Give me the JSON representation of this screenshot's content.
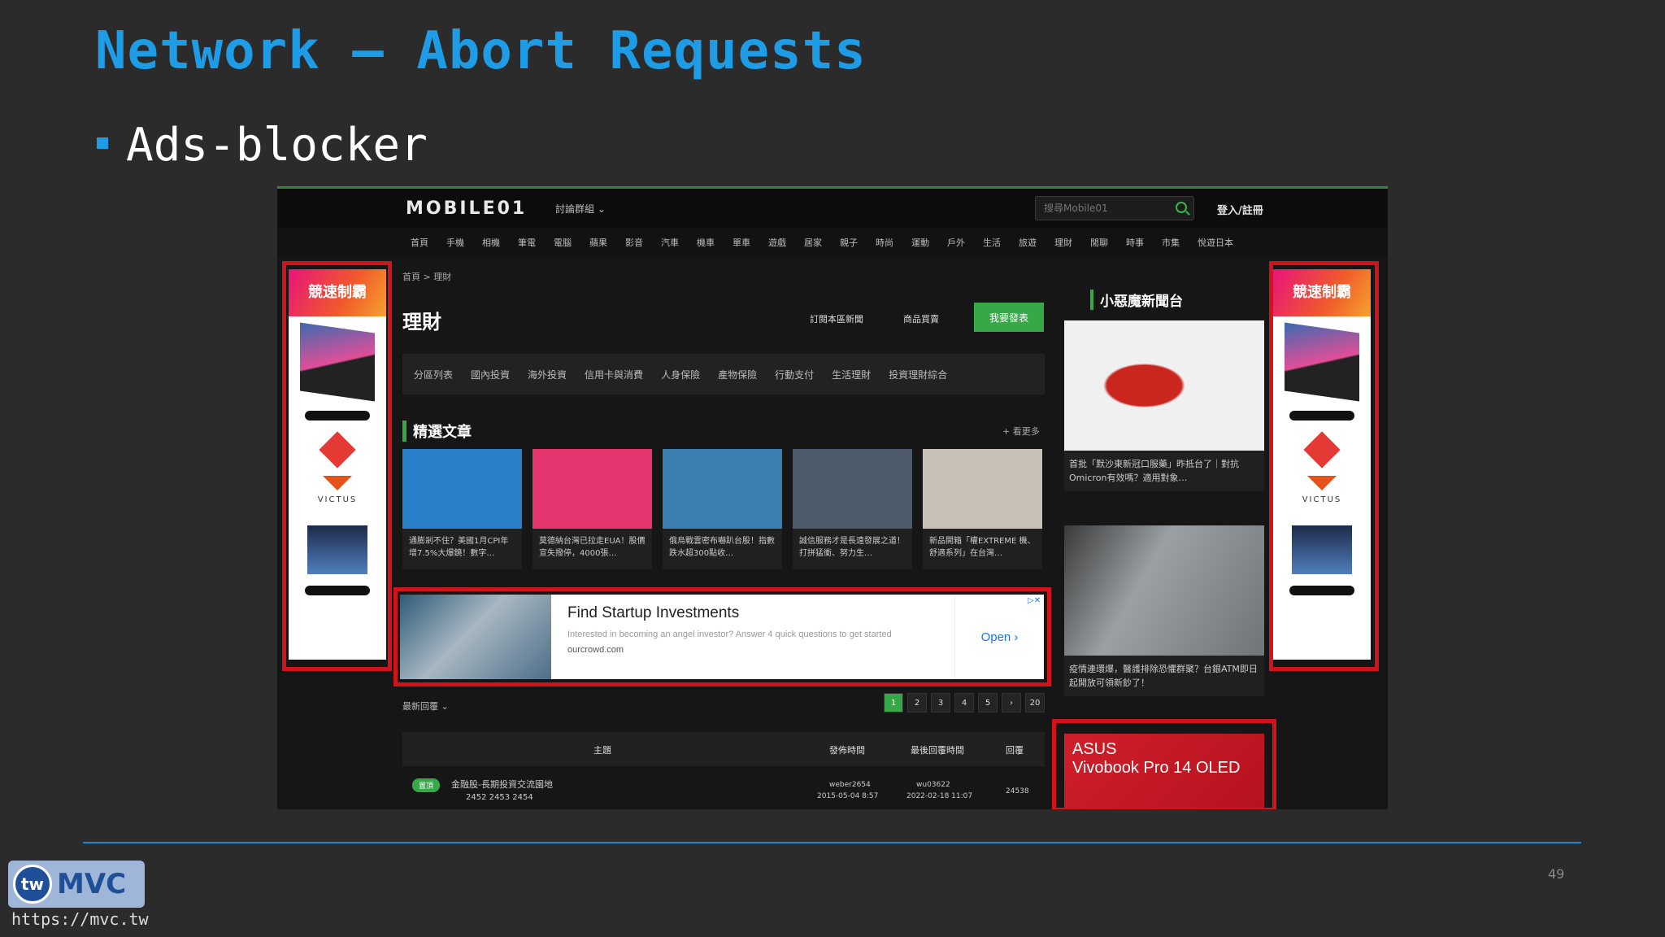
{
  "slide": {
    "title": "Network – Abort Requests",
    "bullet": "Ads-blocker",
    "page_number": "49",
    "footer_url": "https://mvc.tw",
    "brand_tw": "tw",
    "brand_mvc": "MVC"
  },
  "site": {
    "logo": "MOBILE01",
    "forum_menu": "討論群組 ⌄",
    "search_placeholder": "搜尋Mobile01",
    "login": "登入/註冊",
    "categories": [
      "首頁",
      "手機",
      "相機",
      "筆電",
      "電腦",
      "蘋果",
      "影音",
      "汽車",
      "機車",
      "單車",
      "遊戲",
      "居家",
      "親子",
      "時尚",
      "運動",
      "戶外",
      "生活",
      "旅遊",
      "理財",
      "閒聊",
      "時事",
      "市集",
      "悅遊日本"
    ],
    "breadcrumb": "首頁 > 理財",
    "heading": "理財",
    "subscribe": "訂閱本區新聞",
    "shop": "商品買賣",
    "post_button": "我要發表",
    "subtabs": [
      "分區列表",
      "國內投資",
      "海外投資",
      "信用卡與消費",
      "人身保險",
      "產物保險",
      "行動支付",
      "生活理財",
      "投資理財綜合"
    ],
    "featured_heading": "精選文章",
    "see_more": "+ 看更多",
    "cards": [
      {
        "text": "通膨剎不住？美國1月CPI年增7.5%大爆鏡！數字…",
        "color": "#2a80c8"
      },
      {
        "text": "莫德納台灣已拉走EUA！股價宣失撥停，4000張…",
        "color": "#e4376f"
      },
      {
        "text": "俄烏戰雲密布嚇趴台股！指數跌水超300點收…",
        "color": "#3a7fb0"
      },
      {
        "text": "誠信服務才是長遠發展之道！打拼猛衝、努力生…",
        "color": "#4d5a6c"
      },
      {
        "text": "新品開箱「權EXTREME 機、舒適系列」在台灣…",
        "color": "#c9c1b8"
      }
    ],
    "ad": {
      "title": "Find Startup Investments",
      "desc": "Interested in becoming an angel investor? Answer 4 quick questions to get started",
      "url": "ourcrowd.com",
      "open": "Open ›",
      "close": "▷✕"
    },
    "latest_label": "最新回覆 ⌄",
    "pager": [
      "1",
      "2",
      "3",
      "4",
      "5",
      "›",
      "20"
    ],
    "table_headers": {
      "topic": "主題",
      "posted": "發佈時間",
      "last_reply": "最後回覆時間",
      "replies": "回覆"
    },
    "row": {
      "tag": "置頂",
      "title": "金融股-長期投資交流園地",
      "pages": "2452  2453  2454",
      "author": "weber2654",
      "posted": "2015-05-04 8:57",
      "last_user": "wu03622",
      "last_time": "2022-02-18 11:07",
      "replies": "24538"
    },
    "right_heading": "小惡魔新聞台",
    "right_cards": [
      {
        "text": "首批「默沙東新冠口服藥」昨抵台了｜對抗Omicron有效嗎？適用對象…"
      },
      {
        "text": "疫情連環爆，醫護排除恐懼群聚？台銀ATM即日起開放可領新鈔了！"
      }
    ],
    "side_ad": {
      "head": "競速制霸",
      "brand": "VICTUS"
    },
    "asus_ad": {
      "l1": "ASUS",
      "l2": "Vivobook Pro 14 OLED"
    }
  }
}
